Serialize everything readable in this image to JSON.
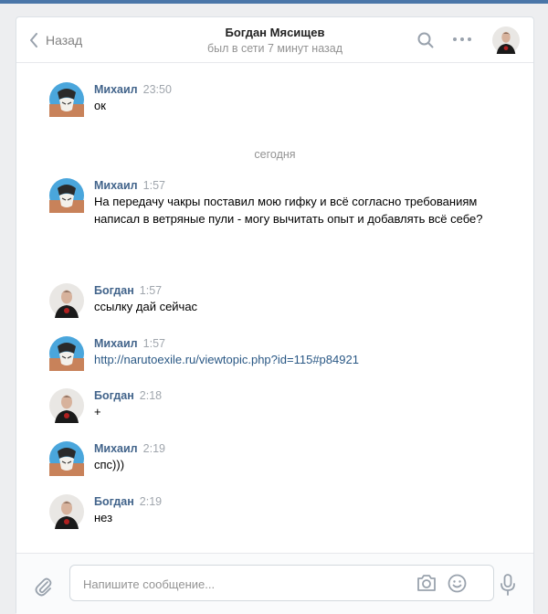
{
  "header": {
    "back_label": "Назад",
    "title": "Богдан Мясищев",
    "status": "был в сети 7 минут назад"
  },
  "messages": [
    {
      "author": "Михаил",
      "time": "23:50",
      "text": "ок",
      "avatar": "mikhail-avatar"
    },
    {
      "author": "Михаил",
      "time": "1:57",
      "text": "На передачу чакры поставил мою гифку и всё согласно требованиям написал в ветряные пули - могу вычитать опыт и добавлять всё себе?",
      "avatar": "mikhail-avatar"
    },
    {
      "author": "Богдан",
      "time": "1:57",
      "text": "ссылку дай сейчас",
      "avatar": "bogdan-avatar"
    },
    {
      "author": "Михаил",
      "time": "1:57",
      "text": "http://narutoexile.ru/viewtopic.php?id=115#p84921",
      "avatar": "mikhail-avatar"
    },
    {
      "author": "Богдан",
      "time": "2:18",
      "text": "+",
      "avatar": "bogdan-avatar"
    },
    {
      "author": "Михаил",
      "time": "2:19",
      "text": "спс)))",
      "avatar": "mikhail-avatar"
    },
    {
      "author": "Богдан",
      "time": "2:19",
      "text": "нез",
      "avatar": "bogdan-avatar"
    }
  ],
  "day_separator": "сегодня",
  "composer": {
    "placeholder": "Напишите сообщение...",
    "value": ""
  },
  "icons": {
    "back": "chevron-left-icon",
    "search": "search-icon",
    "more": "more-icon",
    "attach": "paperclip-icon",
    "camera": "camera-icon",
    "emoji": "smile-icon",
    "mic": "microphone-icon"
  },
  "colors": {
    "accent": "#4a76a8",
    "author": "#42648b",
    "link": "#2a5885",
    "muted": "#939393"
  }
}
